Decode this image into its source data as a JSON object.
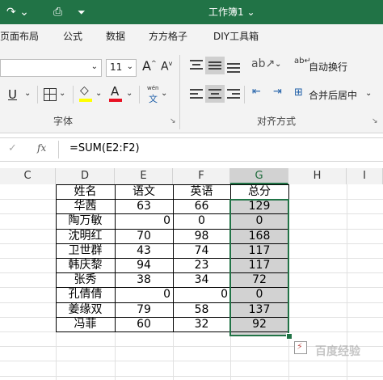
{
  "titlebar": {
    "title": "工作簿1 ⌄"
  },
  "tabs": [
    "页面布局",
    "公式",
    "数据",
    "方方格子",
    "DIY工具箱"
  ],
  "font_group": {
    "size": "11",
    "grow": "A",
    "shrink": "A",
    "underline": "U",
    "color_letter": "A",
    "wen": "wén",
    "wen_char": "文",
    "label": "字体"
  },
  "align_group": {
    "wrap_text": "自动换行",
    "merge_center": "合并后居中",
    "label": "对齐方式"
  },
  "formula_bar": {
    "cancel": "✓",
    "fx": "fx",
    "formula": "=SUM(E2:F2)"
  },
  "columns": [
    "C",
    "D",
    "E",
    "F",
    "G",
    "H",
    "I"
  ],
  "table": {
    "headers": [
      "姓名",
      "语文",
      "英语",
      "总分"
    ],
    "rows": [
      [
        "华茜",
        "63",
        "66",
        "129"
      ],
      [
        "陶万敏",
        "0",
        "0",
        "0"
      ],
      [
        "沈明红",
        "70",
        "98",
        "168"
      ],
      [
        "卫世群",
        "43",
        "74",
        "117"
      ],
      [
        "韩庆黎",
        "94",
        "23",
        "117"
      ],
      [
        "张秀",
        "38",
        "34",
        "72"
      ],
      [
        "孔倩倩",
        "0",
        "0",
        "0"
      ],
      [
        "姜缘双",
        "79",
        "58",
        "137"
      ],
      [
        "冯菲",
        "60",
        "32",
        "92"
      ]
    ]
  },
  "watermark": "百度经验",
  "colors": {
    "brand": "#217346",
    "selection": "#d2d2d2",
    "font_red": "#e81123",
    "highlight_yellow": "#ffff00"
  }
}
